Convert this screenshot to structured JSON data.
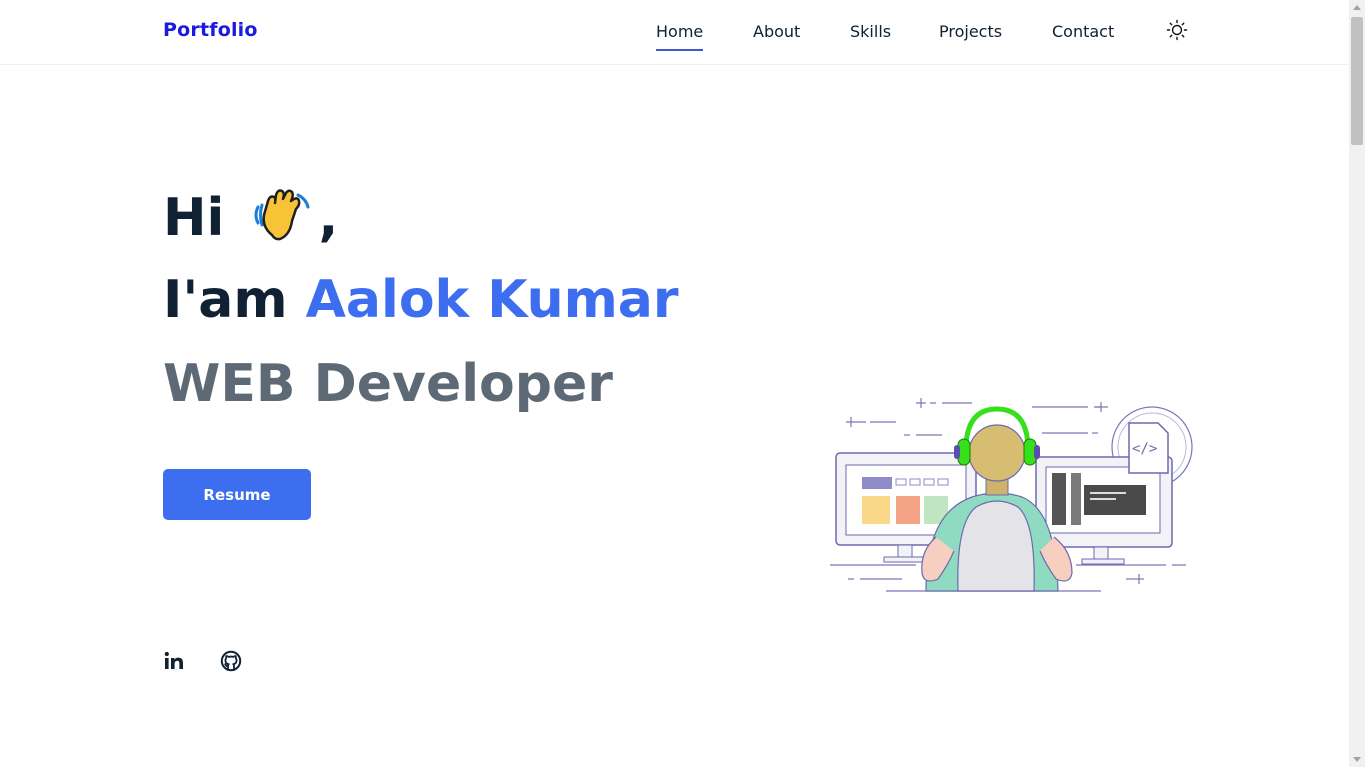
{
  "header": {
    "brand": "Portfolio",
    "nav": [
      {
        "label": "Home",
        "active": true
      },
      {
        "label": "About"
      },
      {
        "label": "Skills"
      },
      {
        "label": "Projects"
      },
      {
        "label": "Contact"
      }
    ],
    "theme_icon": "sun-icon"
  },
  "hero": {
    "greeting": "Hi",
    "greeting_emoji": "waving-hand-icon",
    "greeting_suffix": ",",
    "intro_prefix": "I'am ",
    "name": "Aalok Kumar",
    "role": "WEB Developer",
    "resume_label": "Resume"
  },
  "social": [
    {
      "icon": "linkedin-icon"
    },
    {
      "icon": "github-icon"
    }
  ],
  "colors": {
    "brand": "#1a1ae0",
    "accent": "#3d6ef0",
    "heading": "#0f2133",
    "role": "#5d6a75"
  }
}
